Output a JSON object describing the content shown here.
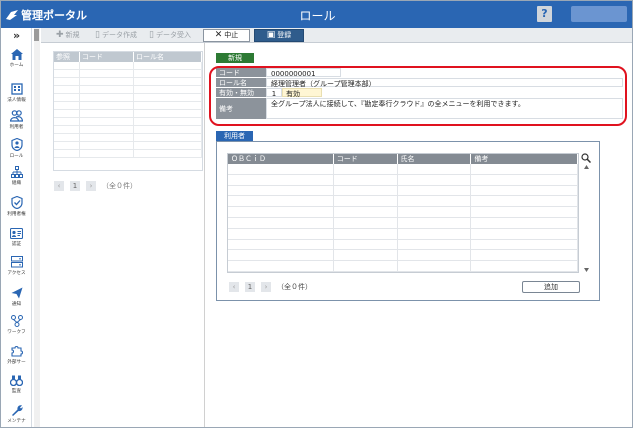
{
  "header": {
    "logo_text": "管理ポータル",
    "title": "ロール",
    "help_label": "?"
  },
  "sidebar": {
    "collapse_label": "»",
    "items": [
      {
        "label": "ホーム",
        "icon": "home-icon"
      },
      {
        "label": "法人情報",
        "icon": "building-icon"
      },
      {
        "label": "利用者",
        "icon": "users-icon"
      },
      {
        "label": "ロール",
        "icon": "role-icon"
      },
      {
        "label": "組織",
        "icon": "org-icon"
      },
      {
        "label": "利用者権",
        "icon": "shield-check-icon"
      },
      {
        "label": "認証",
        "icon": "id-card-icon"
      },
      {
        "label": "アクセス",
        "icon": "server-icon"
      },
      {
        "label": "通知",
        "icon": "paper-plane-icon"
      },
      {
        "label": "ワークフ",
        "icon": "workflow-icon"
      },
      {
        "label": "外部サー",
        "icon": "puzzle-icon"
      },
      {
        "label": "監査",
        "icon": "binoculars-icon"
      },
      {
        "label": "メンテナ",
        "icon": "wrench-icon"
      }
    ]
  },
  "toolbar": {
    "new_label": "新規",
    "data_create_label": "データ作成",
    "data_import_label": "データ受入",
    "cancel_label": "中止",
    "register_label": "登録"
  },
  "list": {
    "columns": [
      "参照",
      "コード",
      "ロール名"
    ],
    "pager_num": "1",
    "count_text": "（全０件）"
  },
  "detail": {
    "mode_tag": "新規",
    "fields": {
      "code_label": "コード",
      "code_value": "0000000001",
      "name_label": "ロール名",
      "name_value": "経理管理者（グループ管理本部）",
      "status_label": "有効・無効",
      "status_num": "1",
      "status_text": "有効",
      "note_label": "備考",
      "note_value": "全グループ法人に接続して、『勘定奉行クラウド』の全メニューを利用できます。"
    },
    "users": {
      "tag": "利用者",
      "columns": [
        "ＯＢＣｉＤ",
        "コード",
        "氏名",
        "備考"
      ],
      "pager_num": "1",
      "count_text": "（全０件）",
      "add_label": "追加"
    }
  },
  "colors": {
    "header_blue": "#2a66b3",
    "highlight_red": "#e0121f",
    "new_green": "#2d7a34"
  }
}
